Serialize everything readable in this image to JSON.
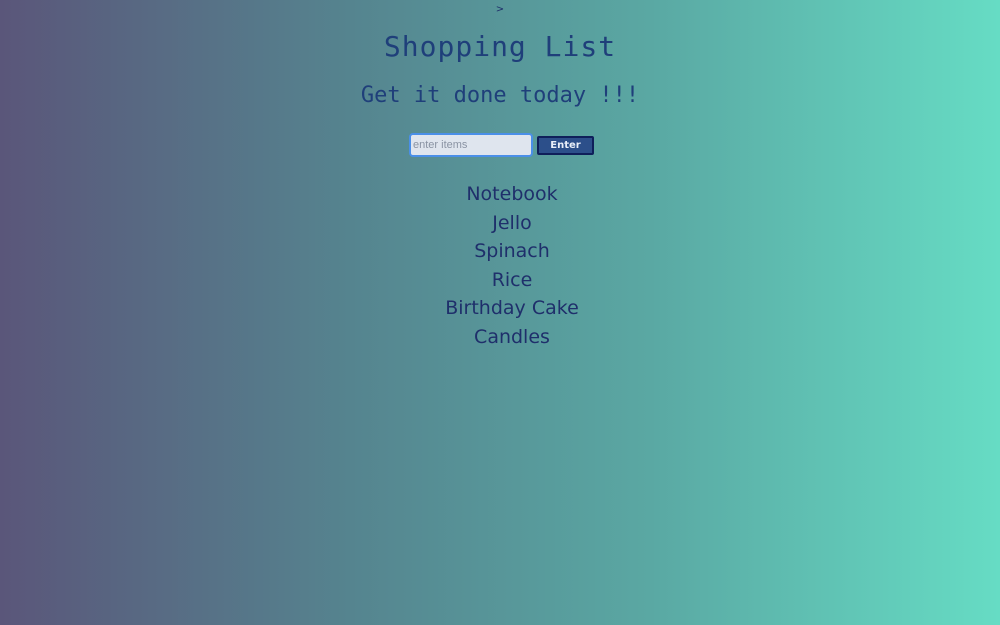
{
  "stray_text": ">",
  "header": {
    "title": "Shopping List",
    "subtitle": "Get it done today !!!"
  },
  "form": {
    "input_value": "",
    "input_placeholder": "enter items",
    "enter_label": "Enter"
  },
  "items": [
    "Notebook",
    "Jello",
    "Spinach",
    "Rice",
    "Birthday Cake",
    "Candles"
  ]
}
